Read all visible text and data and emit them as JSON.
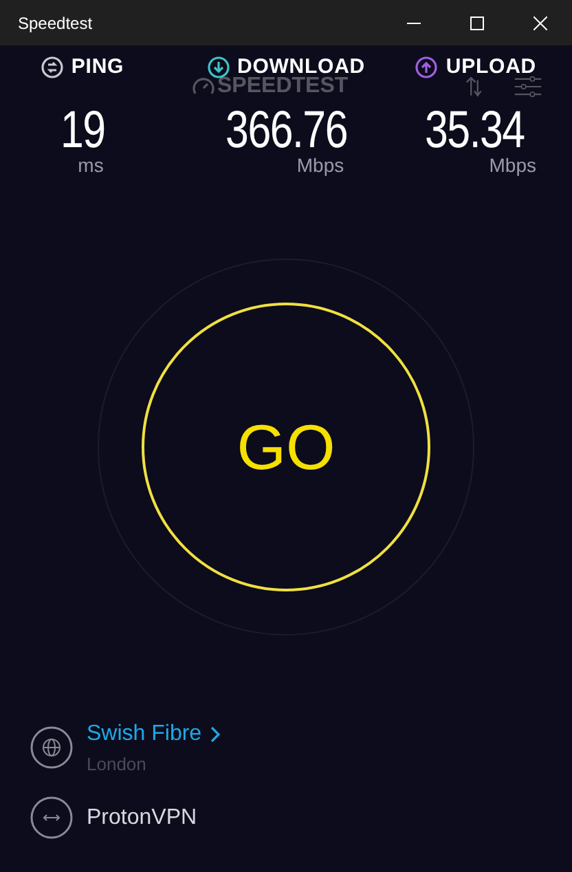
{
  "window": {
    "title": "Speedtest"
  },
  "logo": "SPEEDTEST",
  "metrics": [
    {
      "kind": "ping",
      "label": "PING",
      "value": "19",
      "unit": "ms"
    },
    {
      "kind": "download",
      "label": "DOWNLOAD",
      "value": "366.76",
      "unit": "Mbps"
    },
    {
      "kind": "upload",
      "label": "UPLOAD",
      "value": "35.34",
      "unit": "Mbps"
    }
  ],
  "go_button": "GO",
  "server": {
    "name": "Swish Fibre",
    "location": "London"
  },
  "connection": {
    "name": "ProtonVPN"
  }
}
